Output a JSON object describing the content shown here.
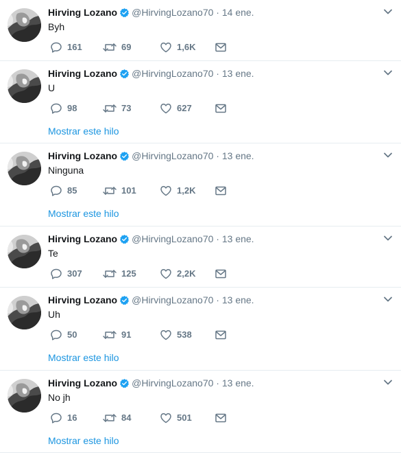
{
  "tweets": [
    {
      "name": "Hirving Lozano",
      "handle": "@HirvingLozano70",
      "sep": "·",
      "date": "14 ene.",
      "text": "Byh",
      "replies": "161",
      "retweets": "69",
      "likes": "1,6K",
      "thread_label": ""
    },
    {
      "name": "Hirving Lozano",
      "handle": "@HirvingLozano70",
      "sep": "·",
      "date": "13 ene.",
      "text": "U",
      "replies": "98",
      "retweets": "73",
      "likes": "627",
      "thread_label": "Mostrar este hilo"
    },
    {
      "name": "Hirving Lozano",
      "handle": "@HirvingLozano70",
      "sep": "·",
      "date": "13 ene.",
      "text": "Ninguna",
      "replies": "85",
      "retweets": "101",
      "likes": "1,2K",
      "thread_label": "Mostrar este hilo"
    },
    {
      "name": "Hirving Lozano",
      "handle": "@HirvingLozano70",
      "sep": "·",
      "date": "13 ene.",
      "text": "Te",
      "replies": "307",
      "retweets": "125",
      "likes": "2,2K",
      "thread_label": ""
    },
    {
      "name": "Hirving Lozano",
      "handle": "@HirvingLozano70",
      "sep": "·",
      "date": "13 ene.",
      "text": "Uh",
      "replies": "50",
      "retweets": "91",
      "likes": "538",
      "thread_label": "Mostrar este hilo"
    },
    {
      "name": "Hirving Lozano",
      "handle": "@HirvingLozano70",
      "sep": "·",
      "date": "13 ene.",
      "text": "No jh",
      "replies": "16",
      "retweets": "84",
      "likes": "501",
      "thread_label": "Mostrar este hilo"
    }
  ],
  "icons": {
    "verified": "verified-badge-icon",
    "caret": "chevron-down-icon",
    "reply": "reply-icon",
    "retweet": "retweet-icon",
    "like": "heart-icon",
    "dm": "envelope-icon"
  },
  "colors": {
    "link": "#1b95e0",
    "muted": "#657786",
    "verified": "#1da1f2",
    "divider": "#e6ecf0"
  }
}
